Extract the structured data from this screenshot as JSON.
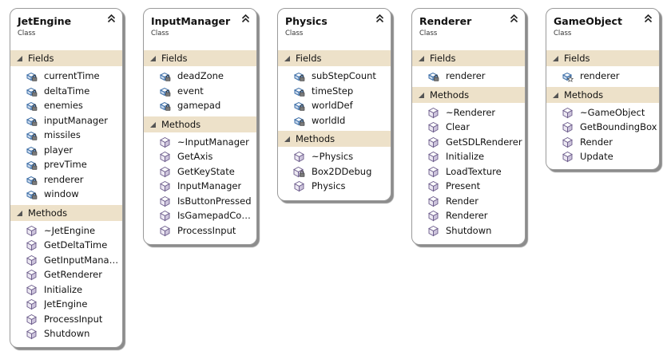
{
  "classes": [
    {
      "name": "JetEngine",
      "kind": "Class",
      "fields_label": "Fields",
      "fields": [
        "currentTime",
        "deltaTime",
        "enemies",
        "inputManager",
        "missiles",
        "player",
        "prevTime",
        "renderer",
        "window"
      ],
      "methods_label": "Methods",
      "methods": [
        "~JetEngine",
        "GetDeltaTime",
        "GetInputManag...",
        "GetRenderer",
        "Initialize",
        "JetEngine",
        "ProcessInput",
        "Shutdown"
      ]
    },
    {
      "name": "InputManager",
      "kind": "Class",
      "fields_label": "Fields",
      "fields": [
        "deadZone",
        "event",
        "gamepad"
      ],
      "methods_label": "Methods",
      "methods": [
        "~InputManager",
        "GetAxis",
        "GetKeyState",
        "InputManager",
        "IsButtonPressed",
        "IsGamepadCon...",
        "ProcessInput"
      ]
    },
    {
      "name": "Physics",
      "kind": "Class",
      "fields_label": "Fields",
      "fields": [
        "subStepCount",
        "timeStep",
        "worldDef",
        "worldId"
      ],
      "methods_label": "Methods",
      "methods": [
        "~Physics",
        "Box2DDebug",
        "Physics"
      ]
    },
    {
      "name": "Renderer",
      "kind": "Class",
      "fields_label": "Fields",
      "fields": [
        "renderer"
      ],
      "methods_label": "Methods",
      "methods": [
        "~Renderer",
        "Clear",
        "GetSDLRenderer",
        "Initialize",
        "LoadTexture",
        "Present",
        "Render",
        "Renderer",
        "Shutdown"
      ]
    },
    {
      "name": "GameObject",
      "kind": "Class",
      "fields_label": "Fields",
      "fields": [
        "renderer"
      ],
      "methods_label": "Methods",
      "methods": [
        "~GameObject",
        "GetBoundingBox",
        "Render",
        "Update"
      ]
    }
  ]
}
